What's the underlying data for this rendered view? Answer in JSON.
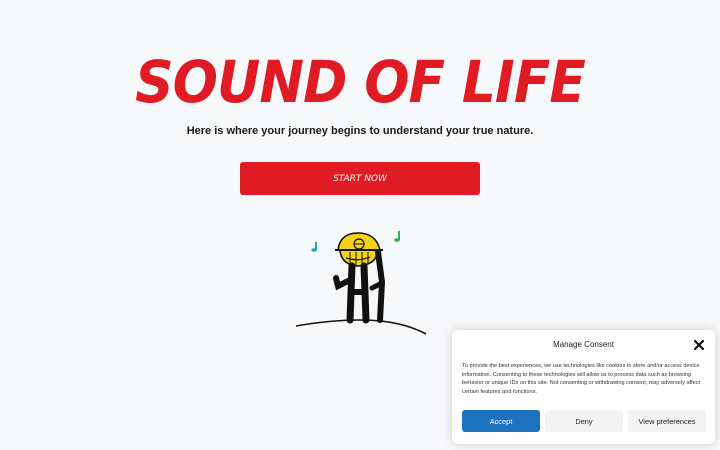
{
  "hero": {
    "title": "SOUND OF LIFE",
    "tagline": "Here is where your journey begins to understand your true nature.",
    "cta_label": "START NOW"
  },
  "illustration": {
    "icon": "stick-figure-with-hat-and-music-notes"
  },
  "consent": {
    "title": "Manage Consent",
    "text": "To provide the best experiences, we use technologies like cookies to store and/or access device information. Consenting to these technologies will allow us to process data such as browsing behavior or unique IDs on this site. Not consenting or withdrawing consent, may adversely affect certain features and functions.",
    "accept_label": "Accept",
    "deny_label": "Deny",
    "preferences_label": "View preferences",
    "close_icon": "close-icon"
  },
  "colors": {
    "brand_red": "#e01b23",
    "accept_blue": "#1e73be",
    "note_teal": "#1aa7a7",
    "note_green": "#2fae4a",
    "hat_yellow": "#f2d21b"
  }
}
